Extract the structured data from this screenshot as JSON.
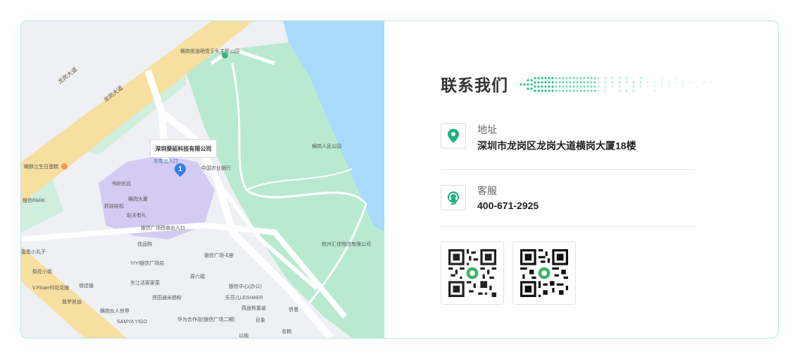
{
  "map": {
    "pin_label": "深圳葵延科技有限公司",
    "pin_number": "1",
    "roads": [
      "龙岗大道",
      "龙岗大道"
    ],
    "pois": [
      "横岗街道晒雪王头主题公园",
      "横岗人民公园",
      "中国农业银行",
      "东南出入口",
      "稀酥兰生日蛋糕",
      "书纷优品",
      "横岗大厦",
      "抓娃娃机",
      "赵夫有礼",
      "银信广场西南出入口",
      "佳品购",
      "银信PARK",
      "银信广场-E座",
      "YIYI银信广场店",
      "周六福",
      "东江活客家菜",
      "银信中心(办公)",
      "资田通米肠粉",
      "乐莎儿LESHAER",
      "横岗女人世界",
      "燕途熊童装",
      "SAMYA YIGO",
      "华为合作店(银信广场二期)",
      "侨恩",
      "巨象",
      "名韩",
      "以纯",
      "杭州汇佳物流有限公司",
      "普罗凯迪",
      "V.Floarr村花花植",
      "梨花小姐",
      "壹鱼小丸子",
      "俏佳银"
    ]
  },
  "contact": {
    "title": "联系我们",
    "address_label": "地址",
    "address_value": "深圳市龙岗区龙岗大道横岗大厦18楼",
    "service_label": "客服",
    "service_value": "400-671-2925",
    "icons": [
      "location-pin-icon",
      "headset-icon"
    ],
    "accent_color": "#1fb080"
  }
}
